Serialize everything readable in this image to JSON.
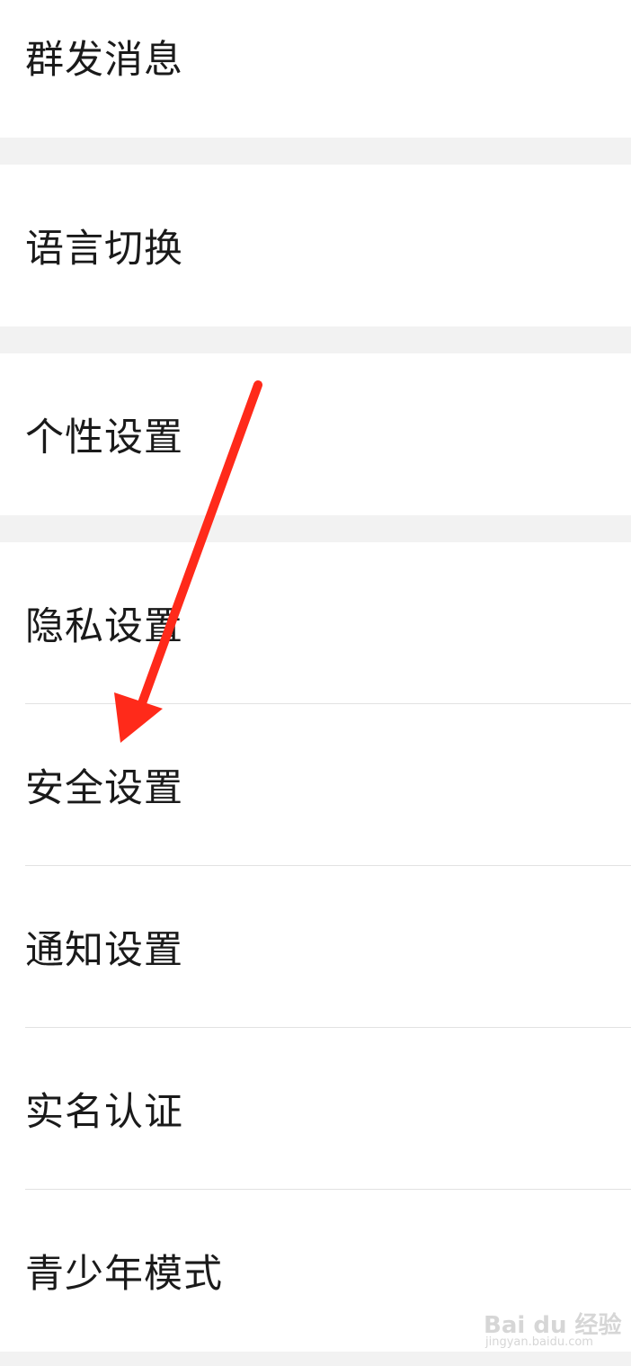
{
  "menu": {
    "group1": [
      "群发消息"
    ],
    "group2": [
      "语言切换"
    ],
    "group3": [
      "个性设置"
    ],
    "group4": [
      "隐私设置",
      "安全设置",
      "通知设置",
      "实名认证",
      "青少年模式"
    ]
  },
  "annotation": {
    "arrow_color": "#ff2a1a",
    "points_to": "安全设置"
  },
  "watermark": {
    "main": "Bai du 经验",
    "sub": "jingyan.baidu.com"
  },
  "colors": {
    "background": "#f2f2f2",
    "row": "#ffffff",
    "text": "#1a1a1a",
    "divider": "#e2e2e2"
  }
}
